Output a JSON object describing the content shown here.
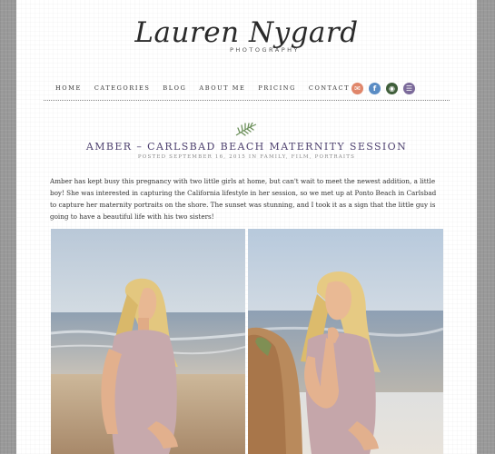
{
  "logo": {
    "name": "Lauren Nygard",
    "sub": "PHOTOGRAPHY"
  },
  "nav": {
    "items": [
      "HOME",
      "CATEGORIES",
      "BLOG",
      "ABOUT ME",
      "PRICING",
      "CONTACT"
    ]
  },
  "social": {
    "icons": [
      {
        "name": "email-icon",
        "color": "#e0866a",
        "glyph": "✉"
      },
      {
        "name": "facebook-icon",
        "color": "#5a8cc4",
        "glyph": "f"
      },
      {
        "name": "instagram-icon",
        "color": "#3f5e3a",
        "glyph": "◉"
      },
      {
        "name": "rss-icon",
        "color": "#7b6a9a",
        "glyph": "☰"
      }
    ]
  },
  "post": {
    "title": "AMBER – CARLSBAD BEACH MATERNITY SESSION",
    "meta": "POSTED SEPTEMBER 16, 2015 IN FAMILY, FILM, PORTRAITS",
    "body": "Amber has kept busy this pregnancy with two little girls at home, but can't wait to meet the newest addition, a little boy! She was interested in capturing the California lifestyle in her session, so we met up at Ponto Beach in Carlsbad to capture her maternity portraits on the shore. The sunset was stunning, and I took it as a sign that the little guy is going to have a beautiful life with his two sisters!"
  },
  "colors": {
    "title": "#4f4270",
    "leaf": "#6b8f5a"
  }
}
